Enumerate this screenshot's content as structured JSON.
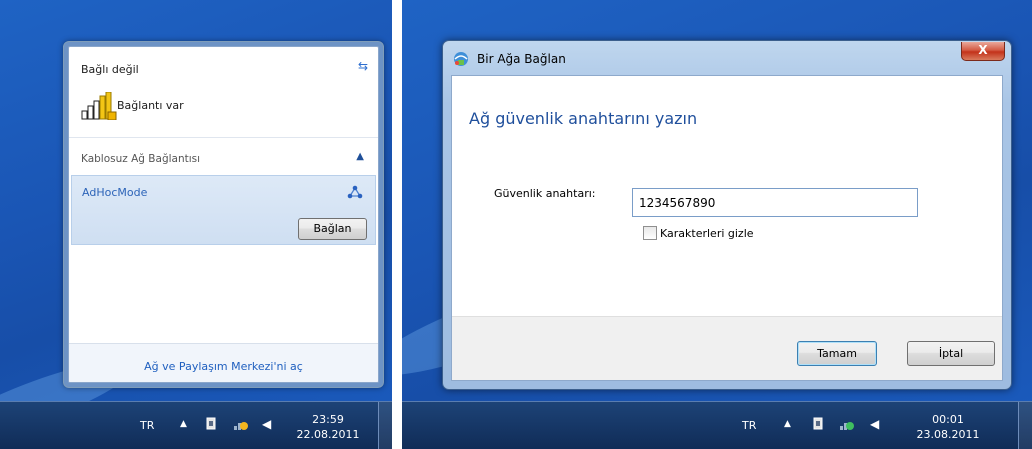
{
  "left_screen": {
    "flyout": {
      "status_text": "Bağlı değil",
      "refresh_icon": "refresh-icon",
      "connection_text": "Bağlantı var",
      "section_title": "Kablosuz Ağ Bağlantısı",
      "network_name": "AdHocMode",
      "connect_button": "Bağlan",
      "footer_link": "Ağ ve Paylaşım Merkezi'ni aç"
    },
    "taskbar": {
      "language": "TR",
      "time": "23:59",
      "date": "22.08.2011"
    }
  },
  "right_screen": {
    "dialog": {
      "title": "Bir Ağa Bağlan",
      "close_label": "X",
      "heading": "Ağ güvenlik anahtarını yazın",
      "key_label": "Güvenlik anahtarı:",
      "key_value": "1234567890",
      "hide_chars_label": "Karakterleri gizle",
      "hide_chars_checked": false,
      "ok_button": "Tamam",
      "cancel_button": "İptal"
    },
    "taskbar": {
      "language": "TR",
      "time": "00:01",
      "date": "23.08.2011"
    }
  },
  "colors": {
    "desktop": "#1a55b4",
    "taskbar": "#102c57",
    "link": "#1f5fbf",
    "heading": "#1f4f9c",
    "close_button": "#c3321a"
  }
}
